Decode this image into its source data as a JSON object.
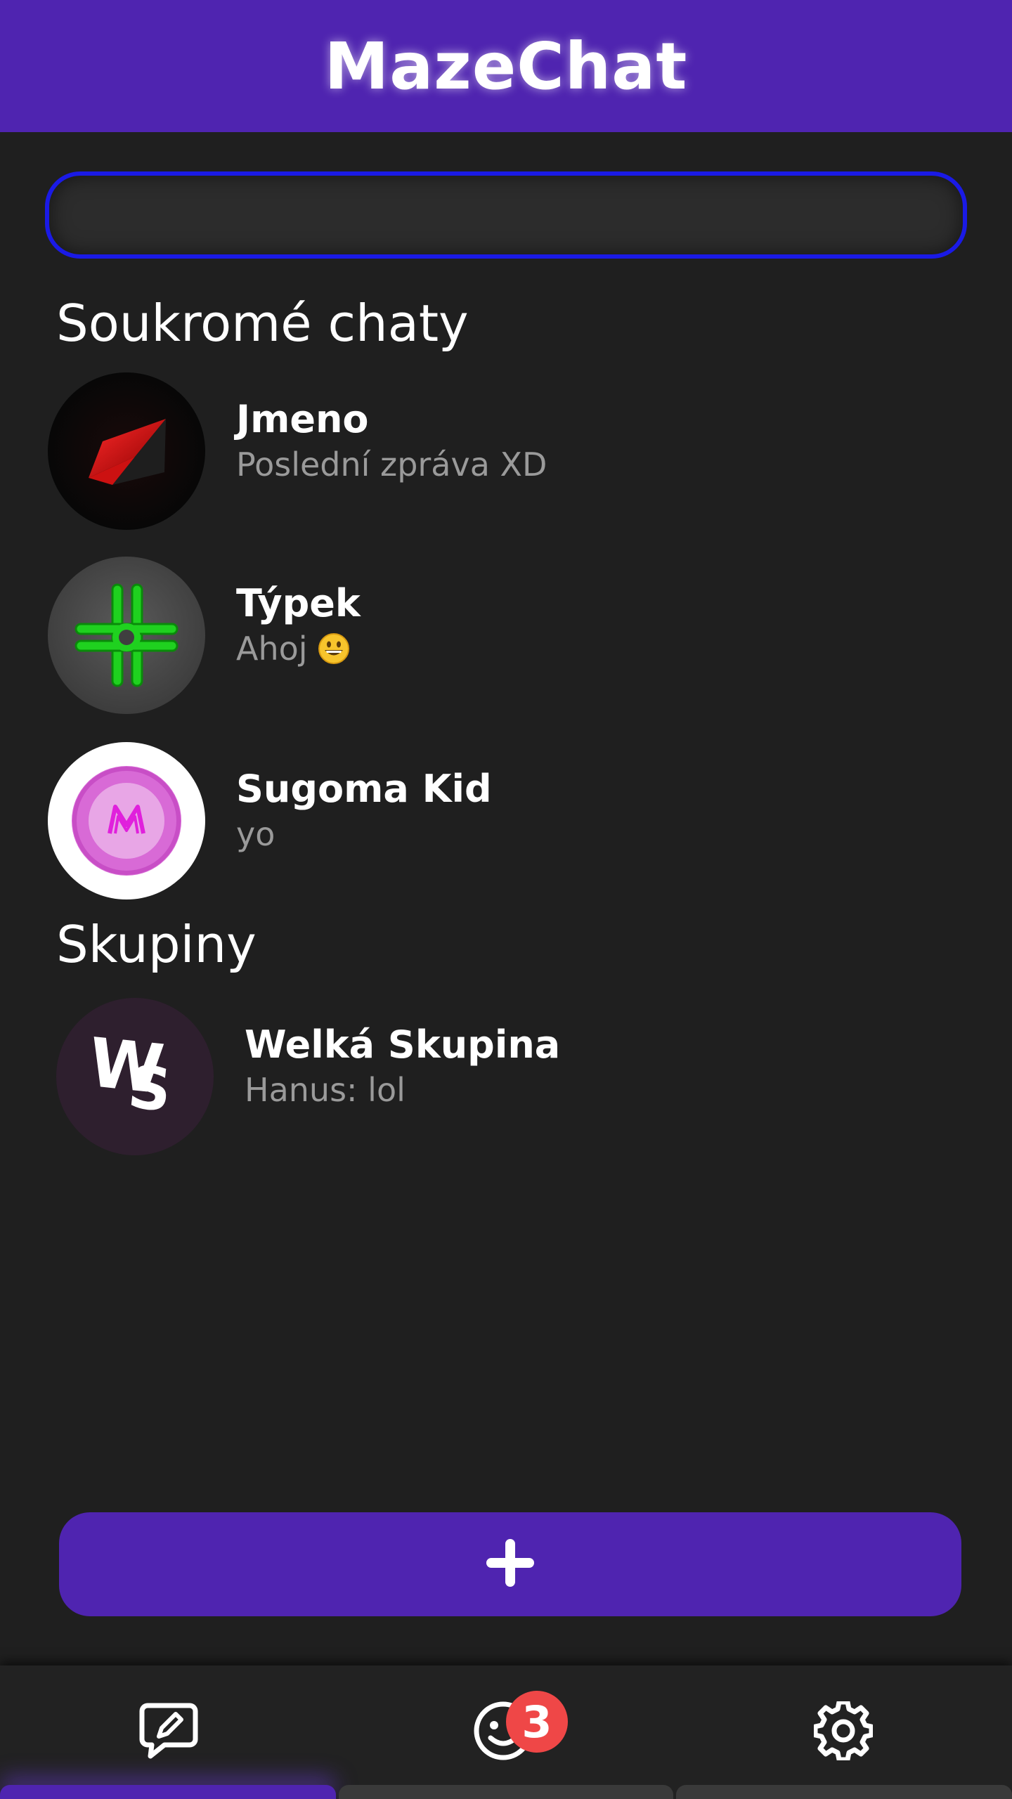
{
  "app": {
    "title": "MazeChat",
    "accent_color": "#4f24b0",
    "background_color": "#1f1f1f"
  },
  "search": {
    "value": "",
    "placeholder": ""
  },
  "private_chats": {
    "title": "Soukromé chaty",
    "items": [
      {
        "name": "Jmeno",
        "preview": "Poslední zpráva XD",
        "avatar_icon": "red-black-shape-avatar"
      },
      {
        "name": "Týpek",
        "preview": "Ahoj",
        "preview_emoji": "grinning-face-emoji",
        "avatar_icon": "green-cross-avatar"
      },
      {
        "name": "Sugoma Kid",
        "preview": "yo",
        "avatar_icon": "pink-ring-avatar"
      }
    ]
  },
  "groups": {
    "title": "Skupiny",
    "items": [
      {
        "name": "Welká Skupina",
        "preview": "Hanus: lol",
        "avatar_icon": "ws-logo-avatar"
      }
    ]
  },
  "actions": {
    "add_icon": "plus-icon"
  },
  "bottom_nav": {
    "items": [
      {
        "icon": "chat-edit-icon",
        "active": true
      },
      {
        "icon": "friends-smiley-icon",
        "badge": "3"
      },
      {
        "icon": "gear-icon"
      }
    ],
    "active_color": "#4f24b0",
    "badge_color": "#ef4747"
  }
}
